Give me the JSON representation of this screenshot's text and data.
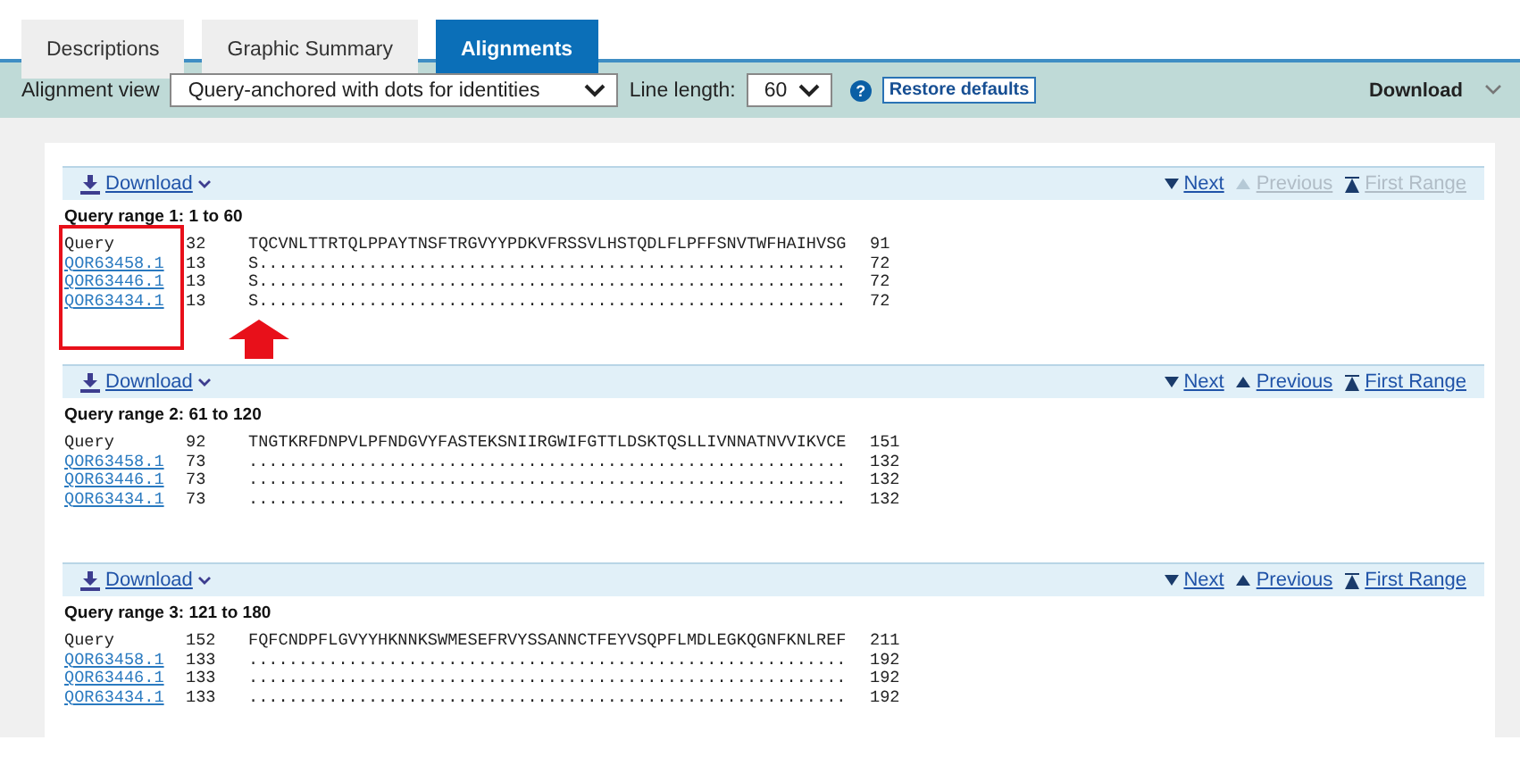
{
  "tabs": [
    {
      "label": "Descriptions",
      "selected": false
    },
    {
      "label": "Graphic Summary",
      "selected": false
    },
    {
      "label": "Alignments",
      "selected": true
    }
  ],
  "toolbar": {
    "view_label": "Alignment view",
    "view_value": "Query-anchored with dots for identities",
    "length_label": "Line length:",
    "length_value": "60",
    "help_icon": "?",
    "restore_button": "Restore defaults",
    "download": "Download"
  },
  "sections": [
    {
      "download": "Download",
      "nav": [
        {
          "kind": "next",
          "label": "Next",
          "disabled": false
        },
        {
          "kind": "previous",
          "label": "Previous",
          "disabled": true
        },
        {
          "kind": "first",
          "label": "First Range",
          "disabled": true
        }
      ],
      "range": "Query range 1: 1 to 60",
      "rows": [
        {
          "name": "Query",
          "link": false,
          "start": "32",
          "seq": "TQCVNLTTRTQLPPAYTNSFTRGVYYPDKVFRSSVLHSTQDLFLPFFSNVTWFHAIHVSG",
          "end": "91"
        },
        {
          "name": "QOR63458.1",
          "link": true,
          "start": "13",
          "seq": "S...........................................................",
          "end": "72"
        },
        {
          "name": "QOR63446.1",
          "link": true,
          "start": "13",
          "seq": "S...........................................................",
          "end": "72"
        },
        {
          "name": "QOR63434.1",
          "link": true,
          "start": "13",
          "seq": "S...........................................................",
          "end": "72"
        }
      ]
    },
    {
      "download": "Download",
      "nav": [
        {
          "kind": "next",
          "label": "Next",
          "disabled": false
        },
        {
          "kind": "previous",
          "label": "Previous",
          "disabled": false
        },
        {
          "kind": "first",
          "label": "First Range",
          "disabled": false
        }
      ],
      "range": "Query range 2: 61 to 120",
      "rows": [
        {
          "name": "Query",
          "link": false,
          "start": "92",
          "seq": "TNGTKRFDNPVLPFNDGVYFASTEKSNIIRGWIFGTTLDSKTQSLLIVNNATNVVIKVCE",
          "end": "151"
        },
        {
          "name": "QOR63458.1",
          "link": true,
          "start": "73",
          "seq": "............................................................",
          "end": "132"
        },
        {
          "name": "QOR63446.1",
          "link": true,
          "start": "73",
          "seq": "............................................................",
          "end": "132"
        },
        {
          "name": "QOR63434.1",
          "link": true,
          "start": "73",
          "seq": "............................................................",
          "end": "132"
        }
      ]
    },
    {
      "download": "Download",
      "nav": [
        {
          "kind": "next",
          "label": "Next",
          "disabled": false
        },
        {
          "kind": "previous",
          "label": "Previous",
          "disabled": false
        },
        {
          "kind": "first",
          "label": "First Range",
          "disabled": false
        }
      ],
      "range": "Query range 3: 121 to 180",
      "rows": [
        {
          "name": "Query",
          "link": false,
          "start": "152",
          "seq": "FQFCNDPFLGVYYHKNNKSWMESEFRVYSSANNCTFEYVSQPFLMDLEGKQGNFKNLREF",
          "end": "211"
        },
        {
          "name": "QOR63458.1",
          "link": true,
          "start": "133",
          "seq": "............................................................",
          "end": "192"
        },
        {
          "name": "QOR63446.1",
          "link": true,
          "start": "133",
          "seq": "............................................................",
          "end": "192"
        },
        {
          "name": "QOR63434.1",
          "link": true,
          "start": "133",
          "seq": "............................................................",
          "end": "192"
        }
      ]
    }
  ]
}
